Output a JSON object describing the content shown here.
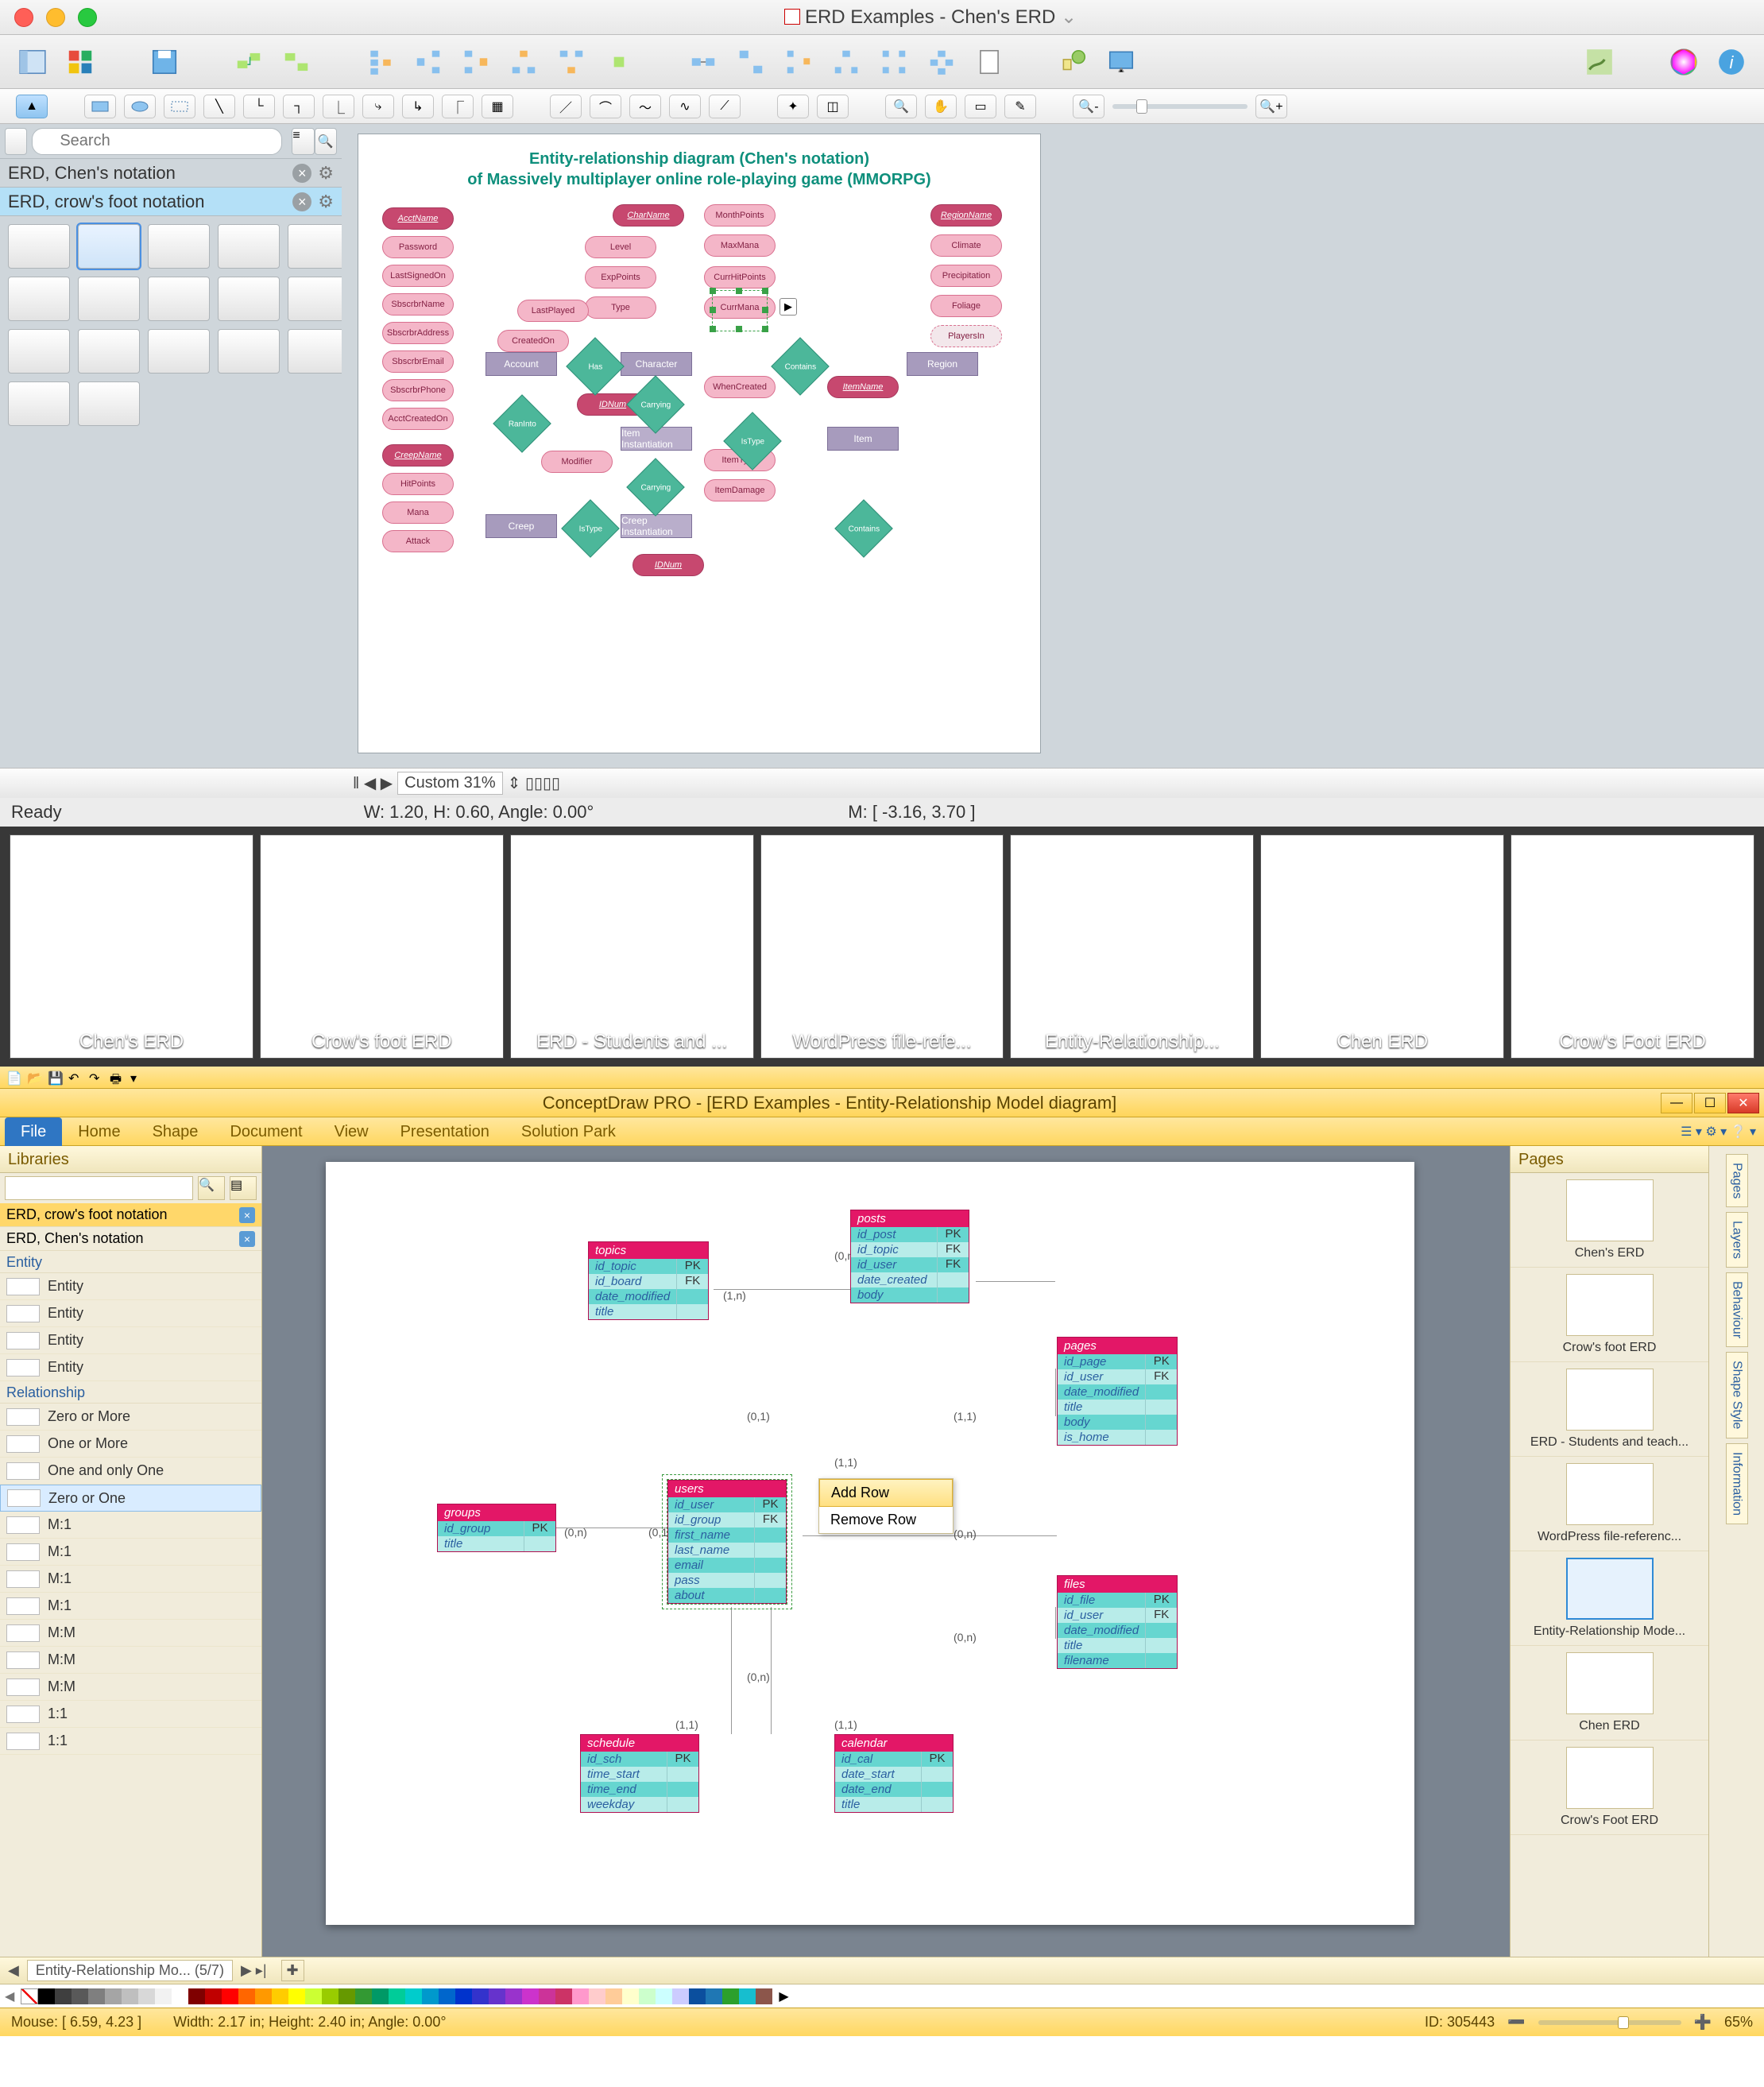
{
  "mac": {
    "title": "ERD Examples - Chen's ERD",
    "search_placeholder": "Search",
    "libraries": [
      {
        "name": "ERD, Chen's notation",
        "active": false
      },
      {
        "name": "ERD, crow's foot notation",
        "active": true
      }
    ],
    "zoom_label": "Custom 31%",
    "status_ready": "Ready",
    "status_dims": "W: 1.20,  H: 0.60,  Angle: 0.00°",
    "status_mouse": "M: [ -3.16, 3.70 ]",
    "erd_title_1": "Entity-relationship diagram (Chen's notation)",
    "erd_title_2": "of Massively multiplayer online role-playing game (MMORPG)",
    "attrs_left": [
      "AcctName",
      "Password",
      "LastSignedOn",
      "SbscrbrName",
      "SbscrbrAddress",
      "SbscrbrEmail",
      "SbscrbrPhone",
      "AcctCreatedOn",
      "CreepName",
      "HitPoints",
      "Mana",
      "Attack"
    ],
    "attrs_mid": [
      "CharName",
      "Level",
      "ExpPoints",
      "Type",
      "LastPlayed",
      "CreatedOn",
      "Modifier",
      "IDNum",
      "IDNum"
    ],
    "attrs_mid2": [
      "MonthPoints",
      "MaxMana",
      "CurrHitPoints",
      "CurrMana",
      "WhenCreated",
      "ItemType",
      "ItemDamage"
    ],
    "attrs_right": [
      "RegionName",
      "Climate",
      "Precipitation",
      "Foliage",
      "PlayersIn",
      "ItemName"
    ],
    "entities": [
      "Account",
      "Character",
      "Region",
      "Item Instantiation",
      "Item",
      "Creep",
      "Creep Instantiation"
    ],
    "relations": [
      "Has",
      "Contains",
      "RanInto",
      "Carrying",
      "IsType",
      "Carrying",
      "IsType",
      "Contains"
    ]
  },
  "strip": [
    "Chen's ERD",
    "Crow's foot ERD",
    "ERD - Students and ...",
    "WordPress file-refe...",
    "Entity-Relationship...",
    "Chen ERD",
    "Crow's Foot ERD"
  ],
  "win": {
    "title": "ConceptDraw PRO - [ERD Examples - Entity-Relationship Model diagram]",
    "ribbon": [
      "File",
      "Home",
      "Shape",
      "Document",
      "View",
      "Presentation",
      "Solution Park"
    ],
    "left_head": "Libraries",
    "libs": [
      {
        "name": "ERD, crow's foot notation",
        "sel": true
      },
      {
        "name": "ERD, Chen's notation",
        "sel": false
      }
    ],
    "sections": {
      "entity": {
        "label": "Entity",
        "items": [
          "Entity",
          "Entity",
          "Entity",
          "Entity"
        ]
      },
      "relationship": {
        "label": "Relationship",
        "items": [
          "Zero or More",
          "One or More",
          "One and only One",
          "Zero or One",
          "M:1",
          "M:1",
          "M:1",
          "M:1",
          "M:M",
          "M:M",
          "M:M",
          "1:1",
          "1:1"
        ]
      }
    },
    "sel_item": "Zero or One",
    "context_menu": [
      "Add Row",
      "Remove Row"
    ],
    "tables": {
      "topics": {
        "title": "topics",
        "rows": [
          [
            "id_topic",
            "PK"
          ],
          [
            "id_board",
            "FK"
          ],
          [
            "date_modified",
            ""
          ],
          [
            "title",
            ""
          ]
        ]
      },
      "posts": {
        "title": "posts",
        "rows": [
          [
            "id_post",
            "PK"
          ],
          [
            "id_topic",
            "FK"
          ],
          [
            "id_user",
            "FK"
          ],
          [
            "date_created",
            ""
          ],
          [
            "body",
            ""
          ]
        ]
      },
      "pages": {
        "title": "pages",
        "rows": [
          [
            "id_page",
            "PK"
          ],
          [
            "id_user",
            "FK"
          ],
          [
            "date_modified",
            ""
          ],
          [
            "title",
            ""
          ],
          [
            "body",
            ""
          ],
          [
            "is_home",
            ""
          ]
        ]
      },
      "groups": {
        "title": "groups",
        "rows": [
          [
            "id_group",
            "PK"
          ],
          [
            "title",
            ""
          ]
        ]
      },
      "users": {
        "title": "users",
        "rows": [
          [
            "id_user",
            "PK"
          ],
          [
            "id_group",
            "FK"
          ],
          [
            "first_name",
            ""
          ],
          [
            "last_name",
            ""
          ],
          [
            "email",
            ""
          ],
          [
            "pass",
            ""
          ],
          [
            "about",
            ""
          ]
        ]
      },
      "files": {
        "title": "files",
        "rows": [
          [
            "id_file",
            "PK"
          ],
          [
            "id_user",
            "FK"
          ],
          [
            "date_modified",
            ""
          ],
          [
            "title",
            ""
          ],
          [
            "filename",
            ""
          ]
        ]
      },
      "schedule": {
        "title": "schedule",
        "rows": [
          [
            "id_sch",
            "PK"
          ],
          [
            "time_start",
            ""
          ],
          [
            "time_end",
            ""
          ],
          [
            "weekday",
            ""
          ]
        ]
      },
      "calendar": {
        "title": "calendar",
        "rows": [
          [
            "id_cal",
            "PK"
          ],
          [
            "date_start",
            ""
          ],
          [
            "date_end",
            ""
          ],
          [
            "title",
            ""
          ]
        ]
      }
    },
    "cardinalities": [
      "(0,n)",
      "(1,n)",
      "(0,1)",
      "(1,1)",
      "(0,n)",
      "(0,1)",
      "(1,1)",
      "(0,n)",
      "(0,n)",
      "(1,1)",
      "(1,1)"
    ],
    "pages_head": "Pages",
    "page_thumbs": [
      "Chen's ERD",
      "Crow's foot ERD",
      "ERD - Students and teach...",
      "WordPress file-referenc...",
      "Entity-Relationship Mode...",
      "Chen ERD",
      "Crow's Foot ERD"
    ],
    "sel_thumb": "Entity-Relationship Mode...",
    "side_tabs": [
      "Pages",
      "Layers",
      "Behaviour",
      "Shape Style",
      "Information"
    ],
    "pagebar_label": "Entity-Relationship Mo...  (5/7)",
    "status": {
      "mouse": "Mouse: [ 6.59, 4.23 ]",
      "dims": "Width: 2.17 in;  Height: 2.40 in;  Angle: 0.00°",
      "id": "ID: 305443",
      "zoom": "65%"
    }
  },
  "colors": [
    "#000000",
    "#3f3f3f",
    "#595959",
    "#7f7f7f",
    "#a5a5a5",
    "#bfbfbf",
    "#d8d8d8",
    "#f2f2f2",
    "#ffffff",
    "#7f0000",
    "#c00000",
    "#ff0000",
    "#ff6600",
    "#ff9900",
    "#ffcc00",
    "#ffff00",
    "#ccff33",
    "#99cc00",
    "#669900",
    "#339933",
    "#009966",
    "#00cc99",
    "#00cccc",
    "#0099cc",
    "#0066cc",
    "#0033cc",
    "#3333cc",
    "#6633cc",
    "#9933cc",
    "#cc33cc",
    "#cc3399",
    "#cc3366",
    "#ff99cc",
    "#ffcccc",
    "#ffcc99",
    "#ffffcc",
    "#ccffcc",
    "#ccffff",
    "#ccccff",
    "#0b4f9e",
    "#1f77b4",
    "#2ca02c",
    "#17becf",
    "#8c564b"
  ]
}
